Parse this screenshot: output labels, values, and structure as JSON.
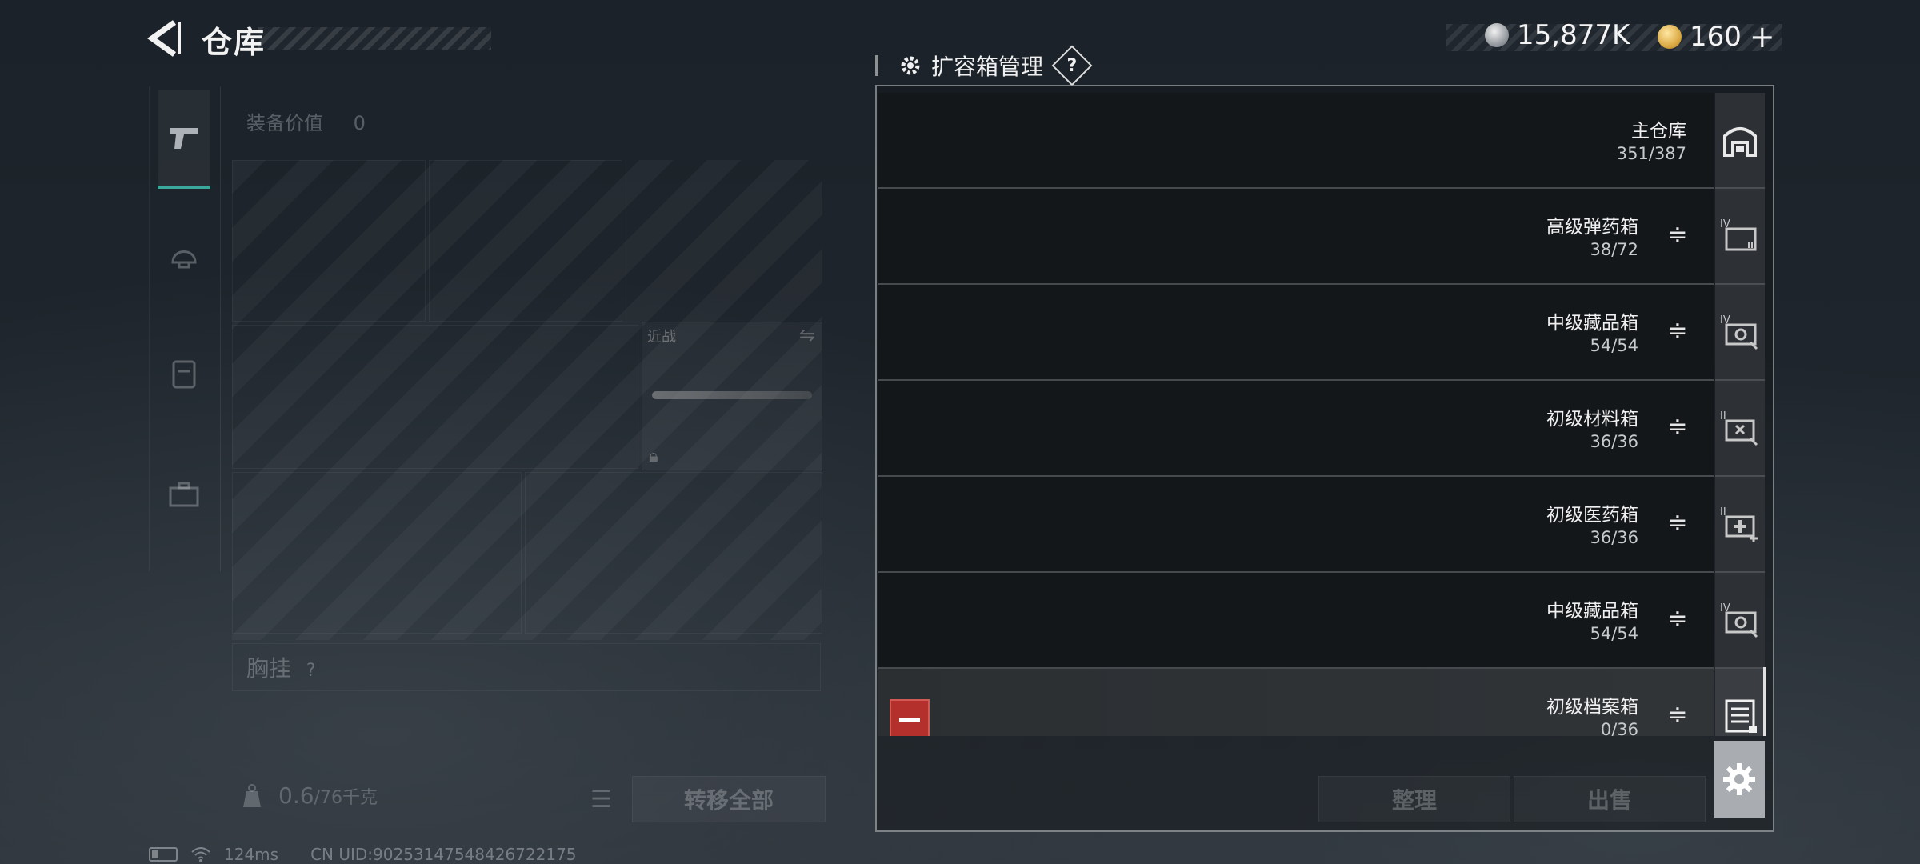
{
  "header": {
    "back_icon": "back-arrow-icon",
    "title": "仓库",
    "currency_silver": "15,877K",
    "currency_gold": "160",
    "currency_gold_plus": "+"
  },
  "left_panel": {
    "tabs": [
      {
        "icon": "pistol-icon",
        "active": true
      },
      {
        "icon": "helmet-icon",
        "active": false
      },
      {
        "icon": "armor-icon",
        "active": false
      },
      {
        "icon": "case-icon",
        "active": false
      }
    ],
    "equip_value_label": "装备价值",
    "equip_value": "0",
    "knife_slot_label": "近战",
    "chest_rig_label": "胸挂",
    "chest_rig_help": "?",
    "weight_current": "0.6",
    "weight_max": "/76千克",
    "transfer_all": "转移全部"
  },
  "manager": {
    "title": "扩容箱管理",
    "help": "?",
    "rows": [
      {
        "name": "主仓库",
        "count": "351/387",
        "icon": "warehouse-icon",
        "type": "main"
      },
      {
        "name": "高级弹药箱",
        "count": "38/72",
        "icon": "ammo-box-icon",
        "tier": "IV"
      },
      {
        "name": "中级藏品箱",
        "count": "54/54",
        "icon": "collection-box-icon",
        "tier": "IV"
      },
      {
        "name": "初级材料箱",
        "count": "36/36",
        "icon": "material-box-icon",
        "tier": "II"
      },
      {
        "name": "初级医药箱",
        "count": "36/36",
        "icon": "medical-box-icon",
        "tier": "II"
      },
      {
        "name": "中级藏品箱",
        "count": "54/54",
        "icon": "collection-box-icon",
        "tier": "IV"
      },
      {
        "name": "初级档案箱",
        "count": "0/36",
        "icon": "archive-box-icon",
        "selected": true
      }
    ],
    "organize": "整理",
    "sell": "出售"
  },
  "status": {
    "ping": "124ms",
    "uid": "CN UID:902531475484267221​75"
  },
  "colors": {
    "accent_teal": "#3aa89a",
    "remove_red": "#b3302c"
  }
}
